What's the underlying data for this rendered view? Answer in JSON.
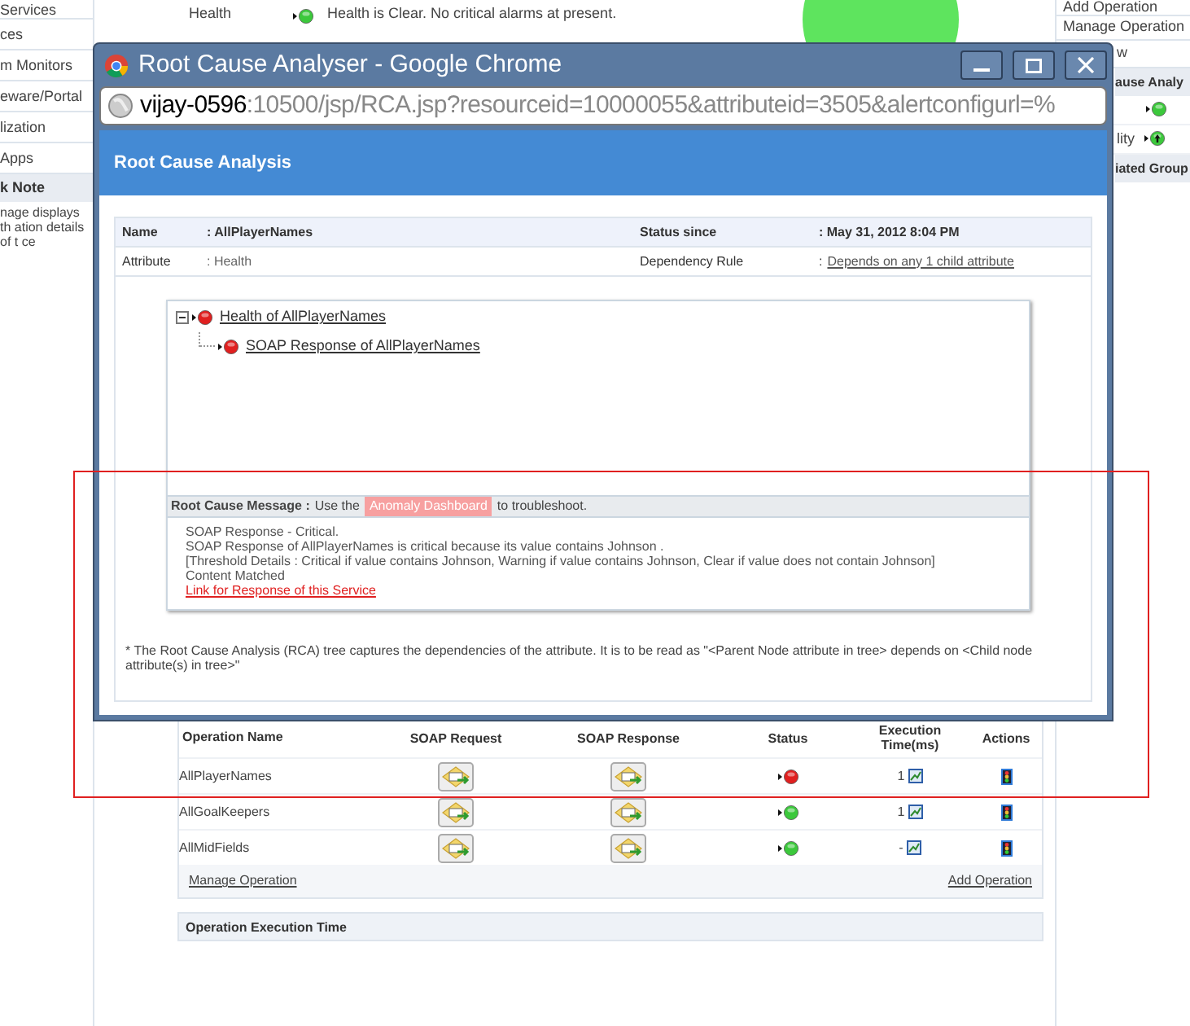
{
  "sidebar": {
    "items": [
      {
        "label": "Services",
        "kind": "link"
      },
      {
        "label": "ces",
        "kind": "link"
      },
      {
        "label": "m Monitors",
        "kind": "link"
      },
      {
        "label": "eware/Portal",
        "kind": "link"
      },
      {
        "label": "lization",
        "kind": "link"
      },
      {
        "label": "Apps",
        "kind": "link"
      },
      {
        "label": "k Note",
        "kind": "header"
      },
      {
        "label": "nage displays th ation details of t ce",
        "kind": "note"
      }
    ]
  },
  "health": {
    "label": "Health",
    "color": "#3cc83c",
    "message": "Health is Clear. No critical alarms at present."
  },
  "right_panel": {
    "links": [
      "Add Operation",
      "Manage Operation",
      "w"
    ],
    "header": "ause Analy",
    "rows": [
      {
        "kind": "dot",
        "color": "#3cc83c"
      },
      {
        "kind": "arrow",
        "label": "lity",
        "color": "#3cc83c"
      }
    ],
    "footer_header": "iated Group"
  },
  "operations": {
    "columns": [
      "Operation Name",
      "SOAP Request",
      "SOAP Response",
      "Status",
      "Execution Time(ms)",
      "Actions"
    ],
    "rows": [
      {
        "name": "AllPlayerNames",
        "color": "#e02020",
        "execution_time": "1"
      },
      {
        "name": "AllGoalKeepers",
        "color": "#3cc83c",
        "execution_time": "1"
      },
      {
        "name": "AllMidFields",
        "color": "#3cc83c",
        "execution_time": "-"
      }
    ],
    "footer_links": [
      "Manage Operation",
      "Add Operation"
    ]
  },
  "execution_section": {
    "title": "Operation Execution Time"
  },
  "popup": {
    "title": "Root Cause Analyser - Google Chrome",
    "url_host": "vijay-0596",
    "url_rest": ":10500/jsp/RCA.jsp?resourceid=10000055&attributeid=3505&alertconfigurl=%",
    "header": "Root Cause Analysis",
    "details": {
      "name_label": "Name",
      "name_value": ": AllPlayerNames",
      "status_since_label": "Status since",
      "status_since_value": ": May 31, 2012 8:04 PM",
      "attribute_label": "Attribute",
      "attribute_value": ": Health",
      "rule_label": "Dependency Rule",
      "rule_colon": ":",
      "rule_value": "Depends on any 1 child attribute"
    },
    "tree": [
      {
        "label": "Health of AllPlayerNames",
        "color": "#e02020",
        "expanded": true,
        "children": [
          {
            "label": "SOAP Response of AllPlayerNames",
            "color": "#e02020"
          }
        ]
      }
    ],
    "message": {
      "label": "Root Cause Message :",
      "prefix": "Use the",
      "link": "Anomaly Dashboard",
      "suffix": "to troubleshoot.",
      "lines": [
        "SOAP Response - Critical.",
        "SOAP Response of AllPlayerNames is critical because its value contains Johnson .",
        "[Threshold Details : Critical if value contains Johnson, Warning if value contains Johnson, Clear if value does not contain Johnson]",
        "Content Matched"
      ],
      "response_link": "Link for Response of this Service"
    },
    "footnote": "* The Root Cause Analysis (RCA) tree captures the dependencies of the attribute. It is to be read as \"<Parent Node attribute in tree> depends on <Child node attribute(s) in tree>\""
  }
}
